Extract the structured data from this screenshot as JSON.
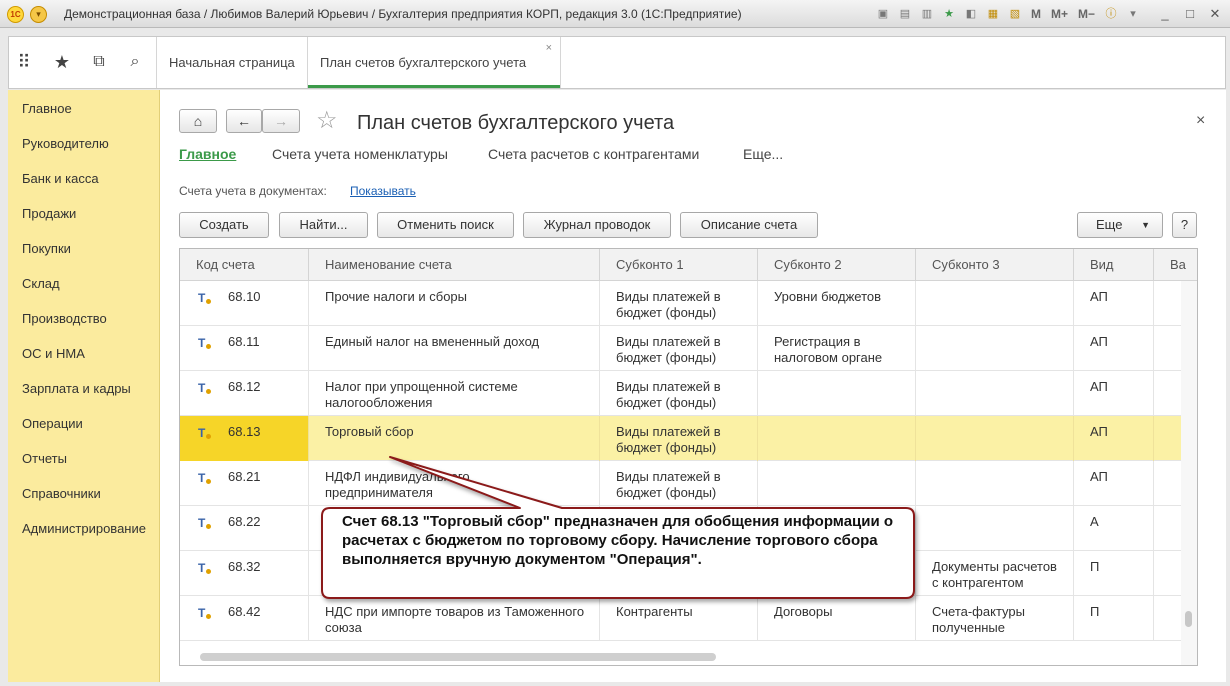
{
  "window": {
    "title": "Демонстрационная база / Любимов Валерий Юрьевич / Бухгалтерия предприятия КОРП, редакция 3.0  (1С:Предприятие)",
    "tools": [
      "M",
      "M+",
      "M−"
    ]
  },
  "toppanel": {
    "tabs": [
      {
        "label": "Начальная страница"
      },
      {
        "label": "План счетов бухгалтерского учета",
        "close": "×"
      }
    ]
  },
  "sidebar": {
    "items": [
      {
        "label": "Главное"
      },
      {
        "label": "Руководителю"
      },
      {
        "label": "Банк и касса"
      },
      {
        "label": "Продажи"
      },
      {
        "label": "Покупки"
      },
      {
        "label": "Склад"
      },
      {
        "label": "Производство"
      },
      {
        "label": "ОС и НМА"
      },
      {
        "label": "Зарплата и кадры"
      },
      {
        "label": "Операции"
      },
      {
        "label": "Отчеты"
      },
      {
        "label": "Справочники"
      },
      {
        "label": "Администрирование"
      }
    ]
  },
  "form": {
    "title": "План счетов бухгалтерского учета",
    "close": "×",
    "sections": [
      "Главное",
      "Счета учета номенклатуры",
      "Счета расчетов с контрагентами",
      "Еще..."
    ],
    "docs_label": "Счета учета в документах:",
    "docs_link": "Показывать",
    "commands": {
      "create": "Создать",
      "find": "Найти...",
      "cancel_search": "Отменить поиск",
      "journal": "Журнал проводок",
      "description": "Описание счета",
      "more": "Еще",
      "help": "?"
    }
  },
  "table": {
    "columns": [
      "Код счета",
      "Наименование счета",
      "Субконто 1",
      "Субконто 2",
      "Субконто 3",
      "Вид",
      "Ва"
    ],
    "icon_glyph": "T",
    "rows": [
      {
        "code": "68.10",
        "name": "Прочие налоги и сборы",
        "sub1": "Виды платежей в бюджет (фонды)",
        "sub2": "Уровни бюджетов",
        "sub3": "",
        "kind": "АП"
      },
      {
        "code": "68.11",
        "name": "Единый налог на вмененный доход",
        "sub1": "Виды платежей в бюджет (фонды)",
        "sub2": "Регистрация в налоговом органе",
        "sub3": "",
        "kind": "АП"
      },
      {
        "code": "68.12",
        "name": "Налог при упрощенной системе налогообложения",
        "sub1": "Виды платежей в бюджет (фонды)",
        "sub2": "",
        "sub3": "",
        "kind": "АП"
      },
      {
        "code": "68.13",
        "name": "Торговый сбор",
        "sub1": "Виды платежей в бюджет (фонды)",
        "sub2": "",
        "sub3": "",
        "kind": "АП",
        "selected": true
      },
      {
        "code": "68.21",
        "name": "НДФЛ индивидуального предпринимателя",
        "sub1": "Виды платежей в бюджет (фонды)",
        "sub2": "",
        "sub3": "",
        "kind": "АП"
      },
      {
        "code": "68.22",
        "name": "",
        "sub1": "",
        "sub2": "",
        "sub3": "",
        "kind": "А"
      },
      {
        "code": "68.32",
        "name": "",
        "sub1": "",
        "sub2": "",
        "sub3": "Документы расчетов с контрагентом",
        "kind": "П"
      },
      {
        "code": "68.42",
        "name": "НДС при импорте товаров из Таможенного союза",
        "sub1": "Контрагенты",
        "sub2": "Договоры",
        "sub3": "Счета-фактуры полученные",
        "kind": "П"
      }
    ]
  },
  "callout": {
    "text": "Счет 68.13 \"Торговый сбор\" предназначен для обобщения информации о расчетах с бюджетом по торговому сбору. Начисление торгового сбора выполняется вручную документом \"Операция\".",
    "border_color": "#8b1a1a"
  }
}
